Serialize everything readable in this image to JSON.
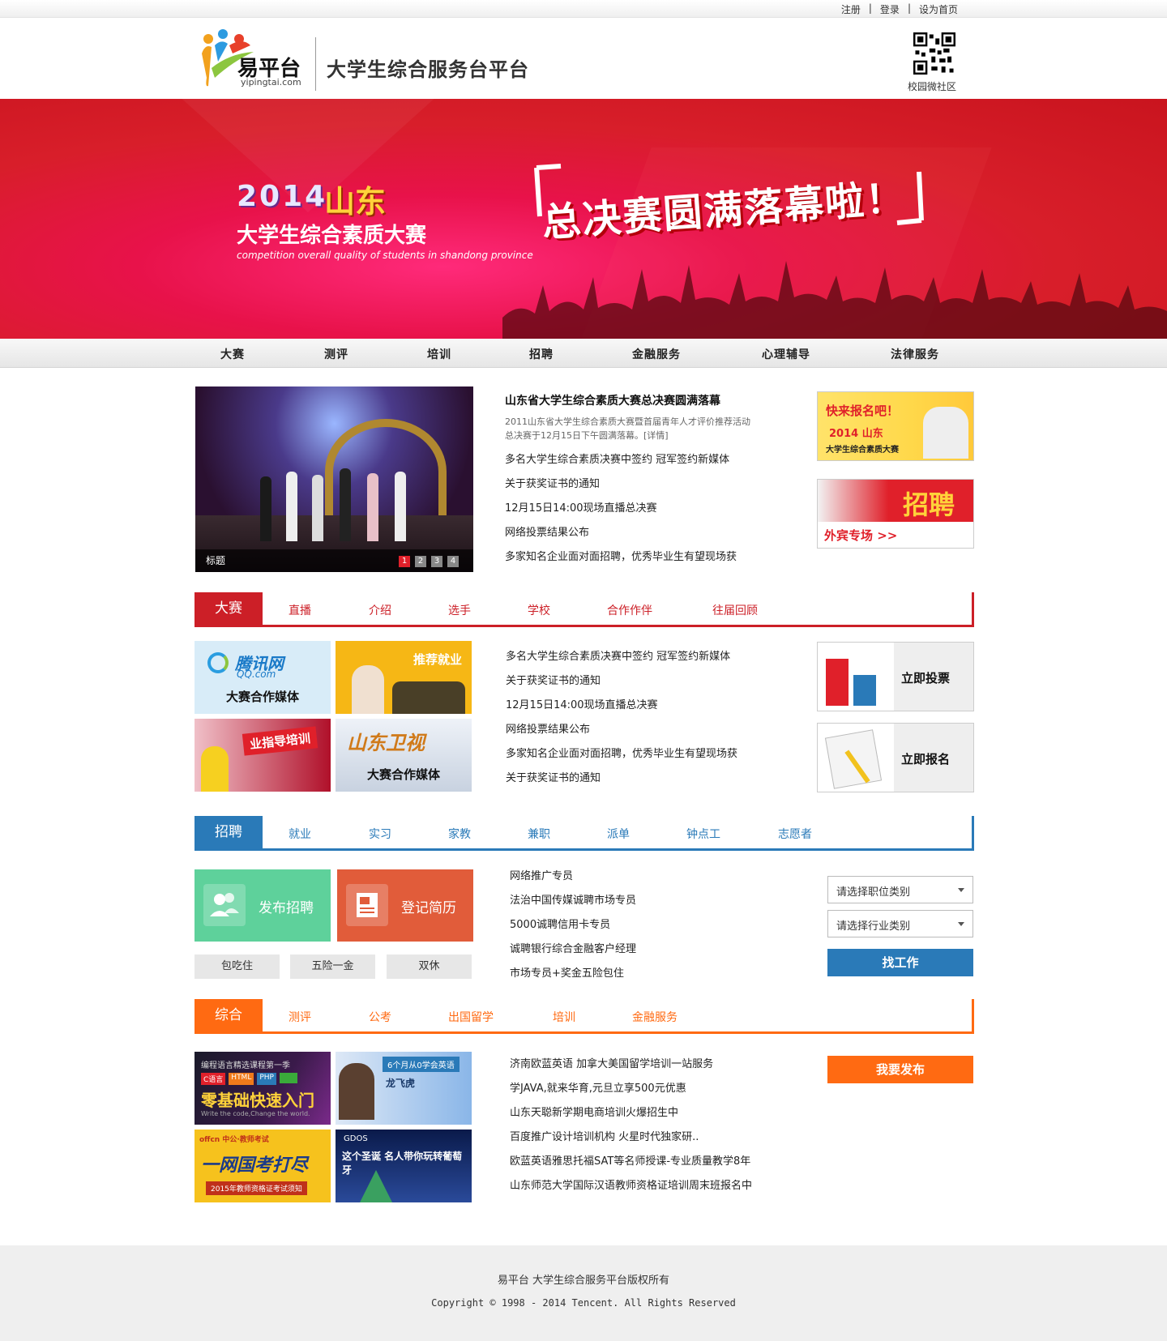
{
  "toplinks": [
    "注册",
    "登录",
    "设为首页"
  ],
  "logo": {
    "text": "易平台",
    "sub": "yipingtai.com"
  },
  "site_title": "大学生综合服务台平台",
  "qr_label": "校园微社区",
  "banner": {
    "year": "2014",
    "province": "山东",
    "name": "大学生综合素质大赛",
    "english": "competition overall quality of students in shandong province",
    "slogan": "总决赛圆满落幕啦！"
  },
  "nav": [
    "大赛",
    "测评",
    "培训",
    "招聘",
    "金融服务",
    "心理辅导",
    "法律服务"
  ],
  "slider": {
    "caption": "标题",
    "dots": [
      "1",
      "2",
      "3",
      "4"
    ]
  },
  "news": {
    "headline": "山东省大学生综合素质大赛总决赛圆满落幕",
    "summary": "2011山东省大学生综合素质大赛暨首届青年人才评价推荐活动总决赛于12月15日下午圆满落幕。[详情]",
    "items": [
      "多名大学生综合素质决赛中签约 冠军签约新媒体",
      "关于获奖证书的通知",
      "12月15日14:00现场直播总决赛",
      "网络投票结果公布",
      "多家知名企业面对面招聘，优秀毕业生有望现场获"
    ]
  },
  "ads": {
    "ad1": {
      "line1": "快来报名吧！",
      "line2": "2014 山东",
      "line3": "大学生综合素质大赛"
    },
    "ad2": {
      "title": "招聘",
      "sub": "外宾专场 >>"
    }
  },
  "contest": {
    "tab": "大赛",
    "subtabs": [
      "直播",
      "介绍",
      "选手",
      "学校",
      "合作作伴",
      "往届回顾"
    ],
    "tiles": [
      {
        "brand": "腾讯网",
        "brand_sub": "QQ.com",
        "label": "大赛合作媒体"
      },
      {
        "label": "推荐就业"
      },
      {
        "label": "业指导培训"
      },
      {
        "brand": "山东卫视",
        "label": "大赛合作媒体"
      }
    ],
    "items": [
      "多名大学生综合素质决赛中签约 冠军签约新媒体",
      "关于获奖证书的通知",
      "12月15日14:00现场直播总决赛",
      "网络投票结果公布",
      "多家知名企业面对面招聘，优秀毕业生有望现场获",
      "关于获奖证书的通知"
    ],
    "vote": "立即投票",
    "signup": "立即报名"
  },
  "jobs": {
    "tab": "招聘",
    "subtabs": [
      "就业",
      "实习",
      "家教",
      "兼职",
      "派单",
      "钟点工",
      "志愿者"
    ],
    "publish": "发布招聘",
    "resume": "登记简历",
    "pills": [
      "包吃住",
      "五险一金",
      "双休"
    ],
    "items": [
      "网络推广专员",
      "法治中国传媒诚聘市场专员",
      "5000诚聘信用卡专员",
      "诚聘银行综合金融客户经理",
      "市场专员+奖金五险包住"
    ],
    "select1": "请选择职位类别",
    "select2": "请选择行业类别",
    "find": "找工作"
  },
  "general": {
    "tab": "综合",
    "subtabs": [
      "测评",
      "公考",
      "出国留学",
      "培训",
      "金融服务"
    ],
    "tiles": [
      {
        "top": "编程语言精选课程第一季",
        "tags": [
          "C语言",
          "HTML",
          "PHP"
        ],
        "label": "零基础快速入门",
        "sub": "Write the code,Change the world."
      },
      {
        "top": "6个月从0学会英语",
        "label": "龙飞虎"
      },
      {
        "top": "offcn 中公·教师考试",
        "label": "一网国考打尽",
        "sub": "2015年教师资格证考试须知"
      },
      {
        "top": "GDOS",
        "label": "这个圣诞 名人带你玩转葡萄牙"
      }
    ],
    "items": [
      "济南欧蓝英语 加拿大美国留学培训一站服务",
      "学JAVA,就来华育,元旦立享500元优惠",
      "山东天聪新学期电商培训火爆招生中",
      "百度推广设计培训机构 火星时代独家研..",
      "欧蓝英语雅思托福SAT等名师授课-专业质量教学8年",
      "山东师范大学国际汉语教师资格证培训周末班报名中"
    ],
    "publish": "我要发布"
  },
  "footer": {
    "line1": "易平台 大学生综合服务平台版权所有",
    "line2": "Copyright © 1998 - 2014 Tencent. All Rights Reserved"
  },
  "colors": {
    "red": "#cc1f27",
    "blue": "#2a7ab8",
    "orange": "#ff6a12",
    "green": "#5ed19b",
    "coral": "#e15c3a"
  }
}
